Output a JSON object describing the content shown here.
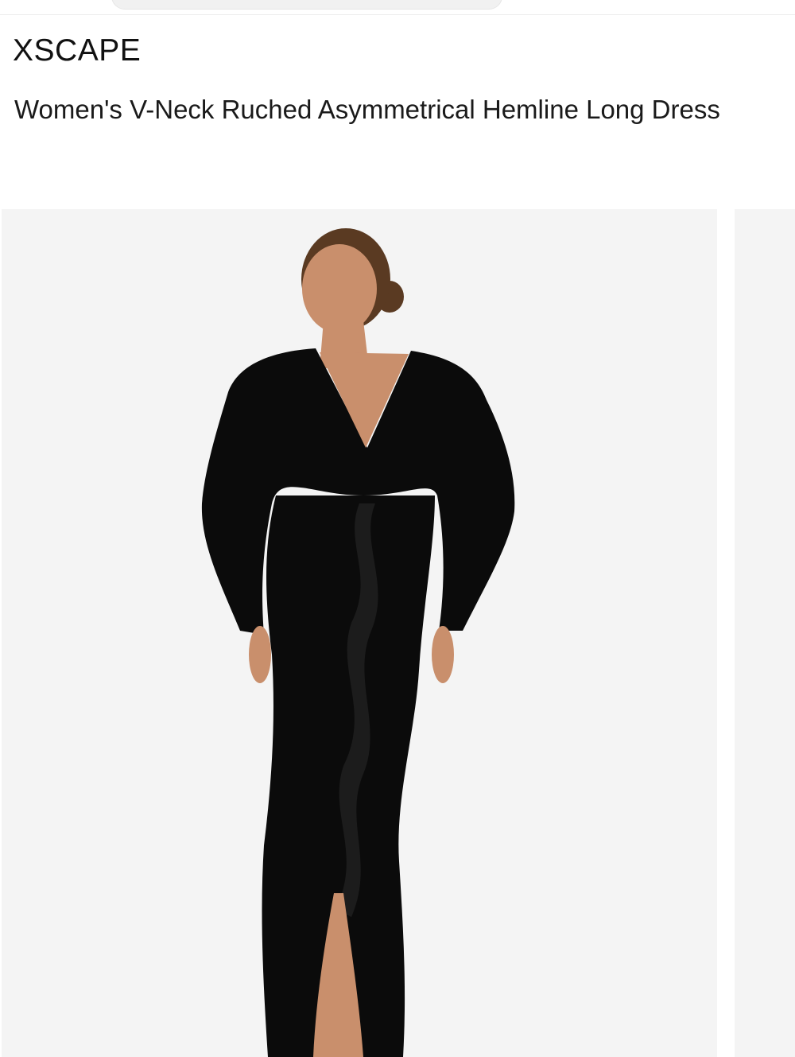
{
  "header": {
    "search_placeholder": ""
  },
  "product": {
    "brand": "XSCAPE",
    "title": "Women's V-Neck Ruched Asymmetrical Hemline Long Dress"
  },
  "gallery": {
    "images": [
      {
        "description_icon": "product-photo"
      },
      {
        "description_icon": "product-photo"
      }
    ],
    "colors": {
      "background": "#f4f4f4",
      "dress": "#0b0b0b",
      "skin": "#c98f6c",
      "hair": "#5a3a22"
    }
  }
}
